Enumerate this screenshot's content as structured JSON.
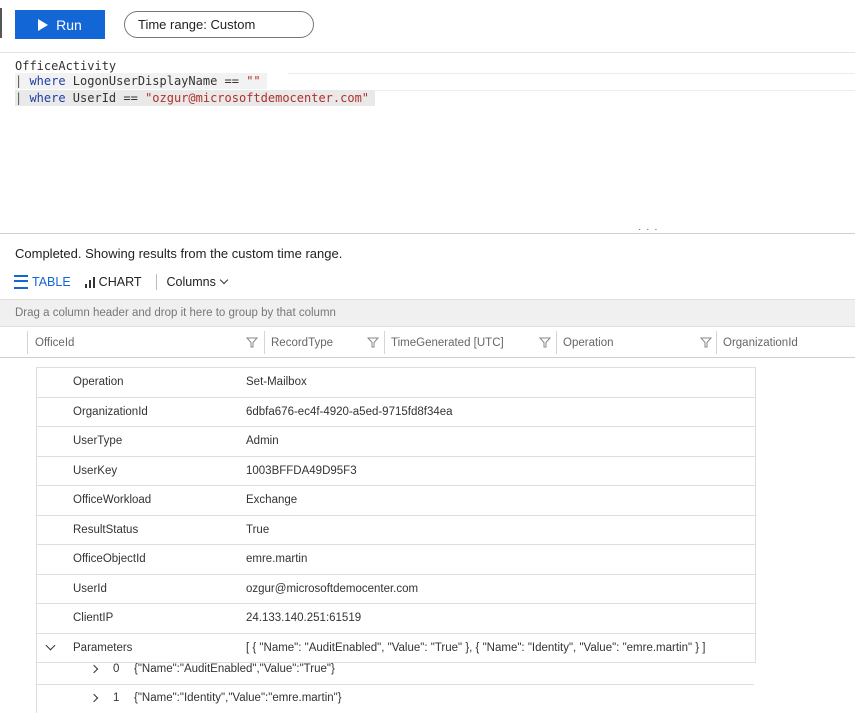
{
  "toolbar": {
    "run_label": "Run",
    "time_range_label": "Time range: Custom"
  },
  "query": {
    "line1": "OfficeActivity",
    "line2_pipe": "| ",
    "line2_kw": "where",
    "line2_field": " LogonUserDisplayName == ",
    "line2_str": "\"\"",
    "line3_pipe": "| ",
    "line3_kw": "where",
    "line3_field": " UserId == ",
    "line3_str": "\"ozgur@microsoftdemocenter.com\""
  },
  "results": {
    "status": "Completed. Showing results from the custom time range.",
    "tabs": {
      "table": "TABLE",
      "chart": "CHART",
      "columns": "Columns"
    },
    "group_hint": "Drag a column header and drop it here to group by that column",
    "columns": [
      "OfficeId",
      "RecordType",
      "TimeGenerated [UTC]",
      "Operation",
      "OrganizationId"
    ],
    "details": [
      {
        "key": "Operation",
        "value": "Set-Mailbox"
      },
      {
        "key": "OrganizationId",
        "value": "6dbfa676-ec4f-4920-a5ed-9715fd8f34ea"
      },
      {
        "key": "UserType",
        "value": "Admin"
      },
      {
        "key": "UserKey",
        "value": "1003BFFDA49D95F3"
      },
      {
        "key": "OfficeWorkload",
        "value": "Exchange"
      },
      {
        "key": "ResultStatus",
        "value": "True"
      },
      {
        "key": "OfficeObjectId",
        "value": "emre.martin"
      },
      {
        "key": "UserId",
        "value": "ozgur@microsoftdemocenter.com"
      },
      {
        "key": "ClientIP",
        "value": "24.133.140.251:61519"
      },
      {
        "key": "Parameters",
        "value": "[ { \"Name\": \"AuditEnabled\", \"Value\": \"True\" }, { \"Name\": \"Identity\", \"Value\": \"emre.martin\" } ]"
      }
    ],
    "parameters": [
      {
        "index": "0",
        "value": "{\"Name\":\"AuditEnabled\",\"Value\":\"True\"}"
      },
      {
        "index": "1",
        "value": "{\"Name\":\"Identity\",\"Value\":\"emre.martin\"}"
      }
    ]
  },
  "colors": {
    "accent": "#1366d6",
    "keyword": "#1f3da3",
    "string": "#b0302a"
  },
  "icons": [
    "play-icon",
    "table-icon",
    "chart-icon",
    "chevron-down-icon",
    "filter-icon",
    "expand-chevron-icon",
    "chevron-right-icon"
  ]
}
